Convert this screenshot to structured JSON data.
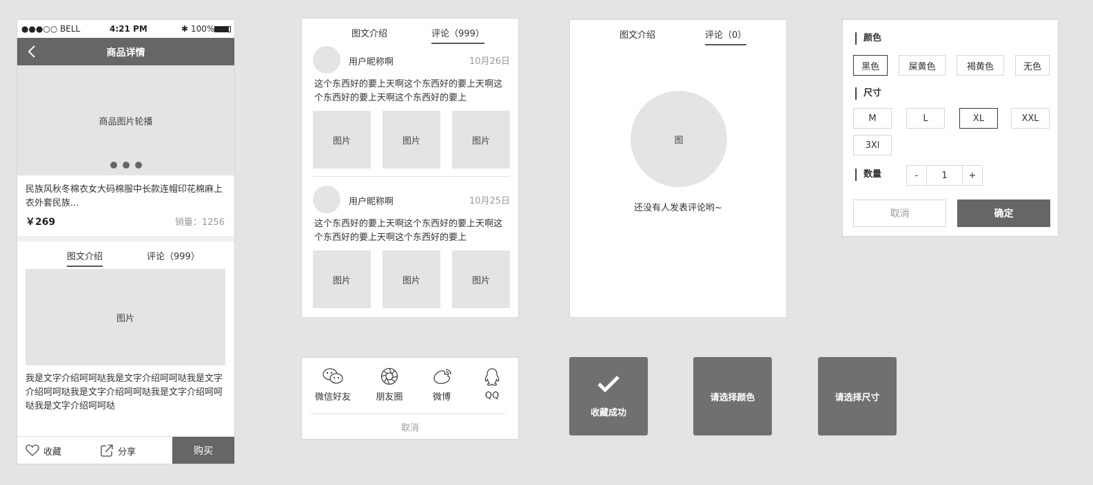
{
  "phone": {
    "status": {
      "carrier": "●●●○○ BELL",
      "time": "4:21 PM",
      "battery": "100%"
    },
    "nav_title": "商品详情",
    "carousel_label": "商品图片轮播",
    "product_name": "民族风秋冬棉衣女大码棉服中长款连帽印花棉麻上衣外套民族...",
    "price": "￥269",
    "sales": "销量：1256",
    "tabs": [
      "图文介绍",
      "评论（999）"
    ],
    "detail_image_label": "图片",
    "detail_text": "我是文字介绍呵呵哒我是文字介绍呵呵哒我是文字介绍呵呵哒我是文字介绍呵呵哒我是文字介绍呵呵哒我是文字介绍呵呵哒",
    "bottom": {
      "favorite": "收藏",
      "share": "分享",
      "buy": "购买"
    }
  },
  "comments_panel": {
    "tabs": [
      "图文介绍",
      "评论（999）"
    ],
    "comments": [
      {
        "user": "用户昵称啊",
        "date": "10月26日",
        "text": "这个东西好的要上天啊这个东西好的要上天啊这个东西好的要上天啊这个东西好的要上",
        "images": [
          "图片",
          "图片",
          "图片"
        ]
      },
      {
        "user": "用户昵称啊",
        "date": "10月25日",
        "text": "这个东西好的要上天啊这个东西好的要上天啊这个东西好的要上天啊这个东西好的要上",
        "images": [
          "图片",
          "图片",
          "图片"
        ]
      }
    ]
  },
  "empty_panel": {
    "tabs": [
      "图文介绍",
      "评论（0）"
    ],
    "image_label": "图",
    "message": "还没有人发表评论哟~"
  },
  "selector": {
    "color_title": "颜色",
    "colors": [
      "黑色",
      "屎黄色",
      "褐黄色",
      "无色"
    ],
    "selected_color": "黑色",
    "size_title": "尺寸",
    "sizes": [
      "M",
      "L",
      "XL",
      "XXL",
      "3Xl"
    ],
    "selected_size": "XL",
    "qty_title": "数量",
    "qty": {
      "minus": "-",
      "value": "1",
      "plus": "+"
    },
    "cancel": "取消",
    "confirm": "确定"
  },
  "share_sheet": {
    "items": [
      {
        "label": "微信好友",
        "icon": "wechat-icon"
      },
      {
        "label": "朋友圈",
        "icon": "moments-icon"
      },
      {
        "label": "微博",
        "icon": "weibo-icon"
      },
      {
        "label": "QQ",
        "icon": "qq-icon"
      }
    ],
    "cancel": "取消"
  },
  "toasts": {
    "favorited": "收藏成功",
    "select_color": "请选择颜色",
    "select_size": "请选择尺寸"
  },
  "colors": {
    "dark": "#666666",
    "placeholder": "#e4e4e4",
    "background": "#e4e4e4"
  }
}
